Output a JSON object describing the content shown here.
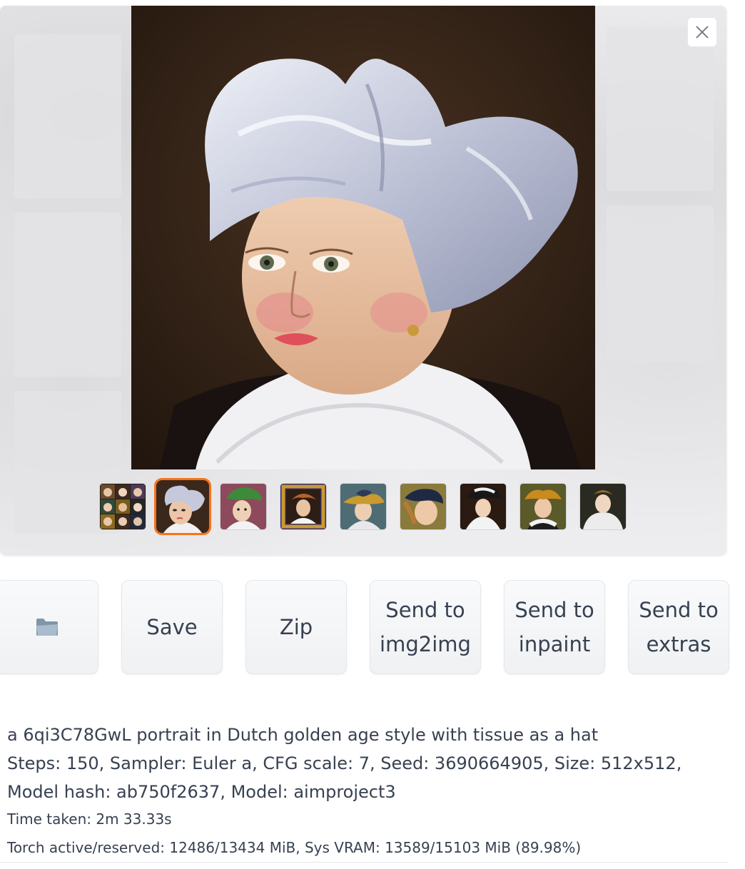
{
  "gallery": {
    "close_icon": "close-icon",
    "thumbnails": [
      {
        "label": "grid-thumbnail"
      },
      {
        "label": "white-hat-portrait",
        "selected": true
      },
      {
        "label": "green-hat-portrait"
      },
      {
        "label": "framed-portrait"
      },
      {
        "label": "gold-hat-portrait"
      },
      {
        "label": "navy-hat-portrait"
      },
      {
        "label": "black-hat-portrait"
      },
      {
        "label": "gold-bow-portrait"
      },
      {
        "label": "ruff-collar-portrait"
      }
    ]
  },
  "actions": {
    "folder_icon": "folder-icon",
    "save": "Save",
    "zip": "Zip",
    "send_img2img": "Send to\nimg2img",
    "send_inpaint": "Send to\ninpaint",
    "send_extras": "Send to\nextras"
  },
  "info": {
    "prompt": "a 6qi3C78GwL portrait in Dutch golden age style with tissue as a hat",
    "params": "Steps: 150, Sampler: Euler a, CFG scale: 7, Seed: 3690664905, Size: 512x512, Model hash: ab750f2637, Model: aimproject3",
    "time_taken": "Time taken: 2m 33.33s",
    "vram": "Torch active/reserved: 12486/13434 MiB, Sys VRAM: 13589/15103 MiB (89.98%)"
  },
  "colors": {
    "accent": "#f97316",
    "text": "#374151"
  }
}
